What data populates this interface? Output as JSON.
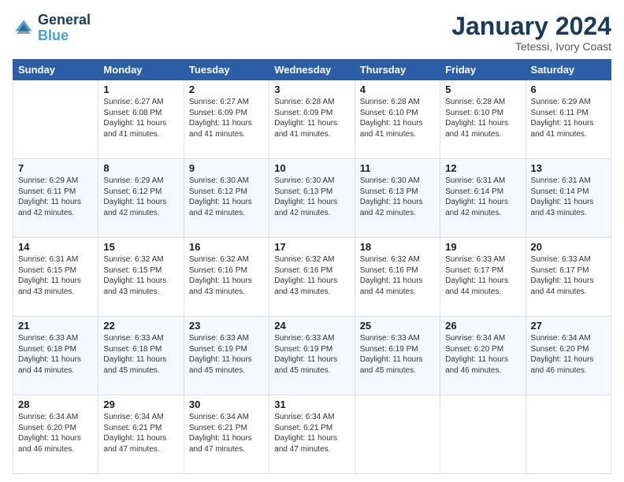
{
  "logo": {
    "line1": "General",
    "line2": "Blue"
  },
  "title": "January 2024",
  "subtitle": "Tetessi, Ivory Coast",
  "weekdays": [
    "Sunday",
    "Monday",
    "Tuesday",
    "Wednesday",
    "Thursday",
    "Friday",
    "Saturday"
  ],
  "weeks": [
    [
      {
        "day": "",
        "info": ""
      },
      {
        "day": "1",
        "info": "Sunrise: 6:27 AM\nSunset: 6:08 PM\nDaylight: 11 hours\nand 41 minutes."
      },
      {
        "day": "2",
        "info": "Sunrise: 6:27 AM\nSunset: 6:09 PM\nDaylight: 11 hours\nand 41 minutes."
      },
      {
        "day": "3",
        "info": "Sunrise: 6:28 AM\nSunset: 6:09 PM\nDaylight: 11 hours\nand 41 minutes."
      },
      {
        "day": "4",
        "info": "Sunrise: 6:28 AM\nSunset: 6:10 PM\nDaylight: 11 hours\nand 41 minutes."
      },
      {
        "day": "5",
        "info": "Sunrise: 6:28 AM\nSunset: 6:10 PM\nDaylight: 11 hours\nand 41 minutes."
      },
      {
        "day": "6",
        "info": "Sunrise: 6:29 AM\nSunset: 6:11 PM\nDaylight: 11 hours\nand 41 minutes."
      }
    ],
    [
      {
        "day": "7",
        "info": "Sunrise: 6:29 AM\nSunset: 6:11 PM\nDaylight: 11 hours\nand 42 minutes."
      },
      {
        "day": "8",
        "info": "Sunrise: 6:29 AM\nSunset: 6:12 PM\nDaylight: 11 hours\nand 42 minutes."
      },
      {
        "day": "9",
        "info": "Sunrise: 6:30 AM\nSunset: 6:12 PM\nDaylight: 11 hours\nand 42 minutes."
      },
      {
        "day": "10",
        "info": "Sunrise: 6:30 AM\nSunset: 6:13 PM\nDaylight: 11 hours\nand 42 minutes."
      },
      {
        "day": "11",
        "info": "Sunrise: 6:30 AM\nSunset: 6:13 PM\nDaylight: 11 hours\nand 42 minutes."
      },
      {
        "day": "12",
        "info": "Sunrise: 6:31 AM\nSunset: 6:14 PM\nDaylight: 11 hours\nand 42 minutes."
      },
      {
        "day": "13",
        "info": "Sunrise: 6:31 AM\nSunset: 6:14 PM\nDaylight: 11 hours\nand 43 minutes."
      }
    ],
    [
      {
        "day": "14",
        "info": "Sunrise: 6:31 AM\nSunset: 6:15 PM\nDaylight: 11 hours\nand 43 minutes."
      },
      {
        "day": "15",
        "info": "Sunrise: 6:32 AM\nSunset: 6:15 PM\nDaylight: 11 hours\nand 43 minutes."
      },
      {
        "day": "16",
        "info": "Sunrise: 6:32 AM\nSunset: 6:16 PM\nDaylight: 11 hours\nand 43 minutes."
      },
      {
        "day": "17",
        "info": "Sunrise: 6:32 AM\nSunset: 6:16 PM\nDaylight: 11 hours\nand 43 minutes."
      },
      {
        "day": "18",
        "info": "Sunrise: 6:32 AM\nSunset: 6:16 PM\nDaylight: 11 hours\nand 44 minutes."
      },
      {
        "day": "19",
        "info": "Sunrise: 6:33 AM\nSunset: 6:17 PM\nDaylight: 11 hours\nand 44 minutes."
      },
      {
        "day": "20",
        "info": "Sunrise: 6:33 AM\nSunset: 6:17 PM\nDaylight: 11 hours\nand 44 minutes."
      }
    ],
    [
      {
        "day": "21",
        "info": "Sunrise: 6:33 AM\nSunset: 6:18 PM\nDaylight: 11 hours\nand 44 minutes."
      },
      {
        "day": "22",
        "info": "Sunrise: 6:33 AM\nSunset: 6:18 PM\nDaylight: 11 hours\nand 45 minutes."
      },
      {
        "day": "23",
        "info": "Sunrise: 6:33 AM\nSunset: 6:19 PM\nDaylight: 11 hours\nand 45 minutes."
      },
      {
        "day": "24",
        "info": "Sunrise: 6:33 AM\nSunset: 6:19 PM\nDaylight: 11 hours\nand 45 minutes."
      },
      {
        "day": "25",
        "info": "Sunrise: 6:33 AM\nSunset: 6:19 PM\nDaylight: 11 hours\nand 45 minutes."
      },
      {
        "day": "26",
        "info": "Sunrise: 6:34 AM\nSunset: 6:20 PM\nDaylight: 11 hours\nand 46 minutes."
      },
      {
        "day": "27",
        "info": "Sunrise: 6:34 AM\nSunset: 6:20 PM\nDaylight: 11 hours\nand 46 minutes."
      }
    ],
    [
      {
        "day": "28",
        "info": "Sunrise: 6:34 AM\nSunset: 6:20 PM\nDaylight: 11 hours\nand 46 minutes."
      },
      {
        "day": "29",
        "info": "Sunrise: 6:34 AM\nSunset: 6:21 PM\nDaylight: 11 hours\nand 47 minutes."
      },
      {
        "day": "30",
        "info": "Sunrise: 6:34 AM\nSunset: 6:21 PM\nDaylight: 11 hours\nand 47 minutes."
      },
      {
        "day": "31",
        "info": "Sunrise: 6:34 AM\nSunset: 6:21 PM\nDaylight: 11 hours\nand 47 minutes."
      },
      {
        "day": "",
        "info": ""
      },
      {
        "day": "",
        "info": ""
      },
      {
        "day": "",
        "info": ""
      }
    ]
  ]
}
